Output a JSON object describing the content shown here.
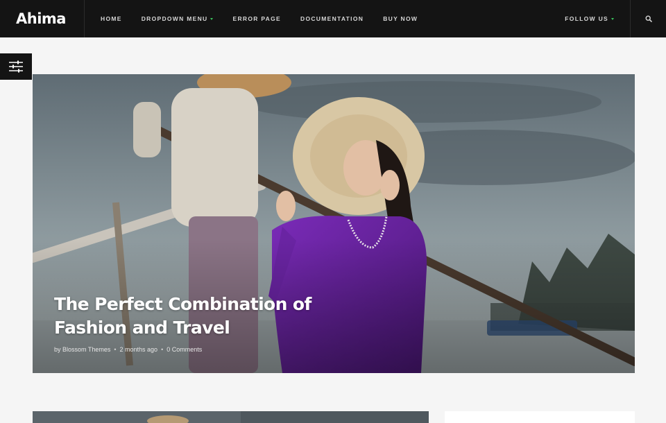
{
  "site": {
    "logo": "Ahima"
  },
  "nav": {
    "items": [
      {
        "label": "HOME",
        "has_dropdown": false
      },
      {
        "label": "DROPDOWN MENU",
        "has_dropdown": true
      },
      {
        "label": "ERROR PAGE",
        "has_dropdown": false
      },
      {
        "label": "DOCUMENTATION",
        "has_dropdown": false
      },
      {
        "label": "BUY NOW",
        "has_dropdown": false
      }
    ],
    "follow_label": "FOLLOW US",
    "search_icon": "search-icon"
  },
  "sidebar_toggle": {
    "icon": "sliders-icon"
  },
  "hero": {
    "title": "The Perfect Combination of Fashion and Travel",
    "meta": {
      "author": "by Blossom Themes",
      "date": "2 months ago",
      "comments": "0 Comments"
    }
  },
  "colors": {
    "header_bg": "#141414",
    "accent": "#39c15b",
    "page_bg": "#f5f5f5"
  }
}
